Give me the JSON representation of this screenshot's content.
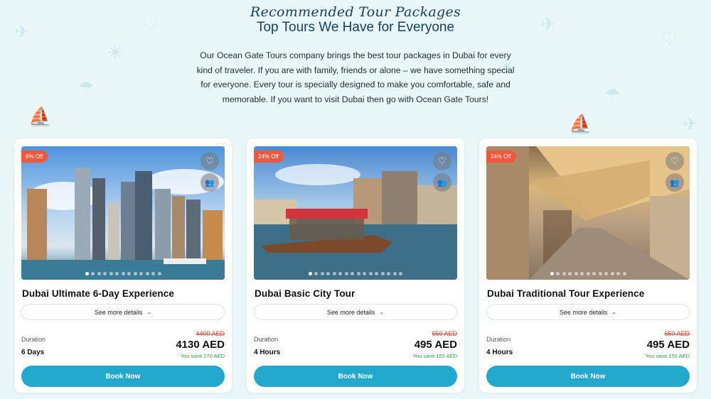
{
  "header": {
    "script_title": "Recommended Tour Packages",
    "main_title": "Top Tours We Have for Everyone",
    "intro": "Our Ocean Gate Tours company brings the best tour packages in Dubai for every kind of traveler. If you are with family, friends or alone – we have something special for everyone. Every tour is specially designed to make you comfortable, safe and memorable. If you want to visit Dubai then go with Ocean Gate Tours!"
  },
  "colors": {
    "accent": "#21a8cc",
    "badge": "#f0573b",
    "old_price": "#e0453a",
    "savings": "#27a745",
    "heading": "#163e5c"
  },
  "cards": [
    {
      "badge": "6% Off",
      "title": "Dubai Ultimate 6-Day Experience",
      "details_label": "See more details",
      "duration_label": "Duration",
      "duration": "6 Days",
      "old_price": "4400 AED",
      "new_price": "4130 AED",
      "save": "You save 270 AED",
      "book_label": "Book Now",
      "slides": 13,
      "active_slide": 0
    },
    {
      "badge": "24% Off",
      "title": "Dubai Basic City Tour",
      "details_label": "See more details",
      "duration_label": "Duration",
      "duration": "4 Hours",
      "old_price": "650 AED",
      "new_price": "495 AED",
      "save": "You save 155 AED",
      "book_label": "Book Now",
      "slides": 16,
      "active_slide": 0
    },
    {
      "badge": "24% Off",
      "title": "Dubai Traditional Tour Experience",
      "details_label": "See more details",
      "duration_label": "Duration",
      "duration": "4 Hours",
      "old_price": "650 AED",
      "new_price": "495 AED",
      "save": "You save 155 AED",
      "book_label": "Book Now",
      "slides": 13,
      "active_slide": 0
    }
  ],
  "icons": {
    "favorite": "heart-icon",
    "group": "group-icon",
    "chevron": "chevron-down-icon"
  }
}
